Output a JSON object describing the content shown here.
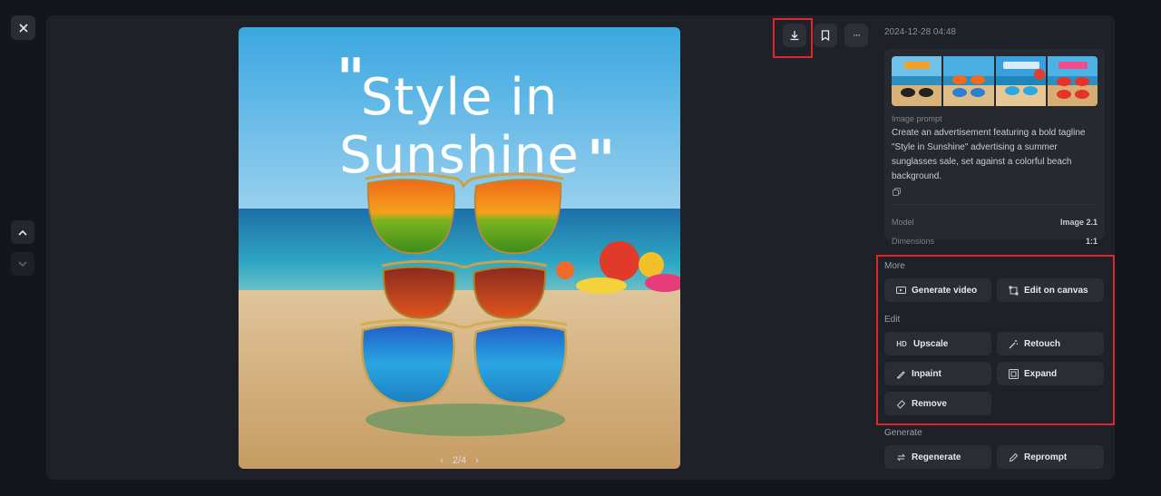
{
  "window": {
    "close_icon": "close-icon"
  },
  "navigation": {
    "up_icon": "chevron-up-icon",
    "down_icon": "chevron-down-icon"
  },
  "image": {
    "headline_line1": "Style in",
    "headline_line2": "Sunshine",
    "quote_left": "\"",
    "quote_right": "\"",
    "pager": {
      "prev": "‹",
      "label": "2/4",
      "next": "›"
    }
  },
  "toolbar": {
    "download_icon": "download-icon",
    "bookmark_icon": "bookmark-icon",
    "more_icon": "more-dots-icon",
    "more_glyph": "···"
  },
  "details": {
    "timestamp": "2024-12-28 04:48",
    "prompt_label": "Image prompt",
    "prompt_text": "Create an advertisement featuring a bold tagline \"Style in Sunshine\" advertising a summer sunglasses sale, set against a colorful beach background.",
    "model_label": "Model",
    "model_value": "Image 2.1",
    "dimensions_label": "Dimensions",
    "dimensions_value": "1:1"
  },
  "more": {
    "title": "More",
    "generate_video": "Generate video",
    "edit_on_canvas": "Edit on canvas"
  },
  "edit": {
    "title": "Edit",
    "upscale_prefix": "HD",
    "upscale": "Upscale",
    "retouch": "Retouch",
    "inpaint": "Inpaint",
    "expand": "Expand",
    "remove": "Remove"
  },
  "generate": {
    "title": "Generate",
    "regenerate": "Regenerate",
    "reprompt": "Reprompt"
  },
  "colors": {
    "highlight": "#e0262d",
    "panel": "#1e2127",
    "button": "#2a2d34"
  }
}
